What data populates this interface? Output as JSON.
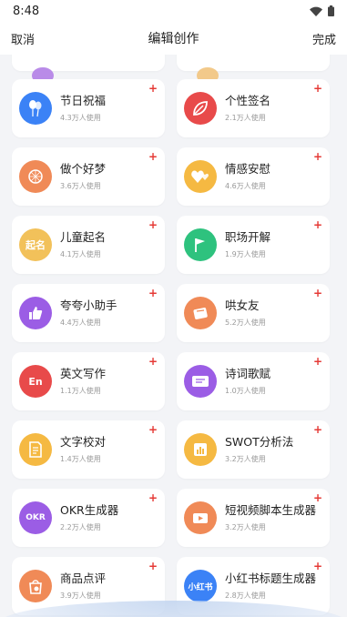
{
  "status": {
    "time": "8:48"
  },
  "header": {
    "cancel": "取消",
    "title": "编辑创作",
    "done": "完成"
  },
  "colors": {
    "accent_plus": "#e53935",
    "background": "#f3f4f7"
  },
  "items": [
    {
      "name": "节日祝福",
      "uses": "4.3万人使用",
      "icon": "balloon-icon",
      "color": "#3b82f6"
    },
    {
      "name": "个性签名",
      "uses": "2.1万人使用",
      "icon": "leaf-icon",
      "color": "#e84a4a"
    },
    {
      "name": "做个好梦",
      "uses": "3.6万人使用",
      "icon": "dreamcatcher-icon",
      "color": "#f08a57"
    },
    {
      "name": "情感安慰",
      "uses": "4.6万人使用",
      "icon": "hearts-icon",
      "color": "#f5b942"
    },
    {
      "name": "儿童起名",
      "uses": "4.1万人使用",
      "icon": "name-badge-icon",
      "color": "#f2c15a",
      "icon_text": "起名"
    },
    {
      "name": "职场开解",
      "uses": "1.9万人使用",
      "icon": "flag-icon",
      "color": "#2ec27e"
    },
    {
      "name": "夸夸小助手",
      "uses": "4.4万人使用",
      "icon": "thumbs-up-icon",
      "color": "#9b5de5"
    },
    {
      "name": "哄女友",
      "uses": "5.2万人使用",
      "icon": "gift-card-icon",
      "color": "#f08a57"
    },
    {
      "name": "英文写作",
      "uses": "1.1万人使用",
      "icon": "english-icon",
      "color": "#e84a4a",
      "icon_text": "En"
    },
    {
      "name": "诗词歌赋",
      "uses": "1.0万人使用",
      "icon": "scroll-icon",
      "color": "#9b5de5"
    },
    {
      "name": "文字校对",
      "uses": "1.4万人使用",
      "icon": "document-icon",
      "color": "#f5b942"
    },
    {
      "name": "SWOT分析法",
      "uses": "3.2万人使用",
      "icon": "bar-chart-icon",
      "color": "#f5b942"
    },
    {
      "name": "OKR生成器",
      "uses": "2.2万人使用",
      "icon": "okr-icon",
      "color": "#9b5de5",
      "icon_text": "OKR"
    },
    {
      "name": "短视频脚本生成器",
      "uses": "3.2万人使用",
      "icon": "video-icon",
      "color": "#f08a57"
    },
    {
      "name": "商品点评",
      "uses": "3.9万人使用",
      "icon": "shopping-bag-icon",
      "color": "#f08a57"
    },
    {
      "name": "小红书标题生成器",
      "uses": "2.8万人使用",
      "icon": "xiaohongshu-icon",
      "color": "#3b82f6",
      "icon_text": "小红书"
    }
  ]
}
